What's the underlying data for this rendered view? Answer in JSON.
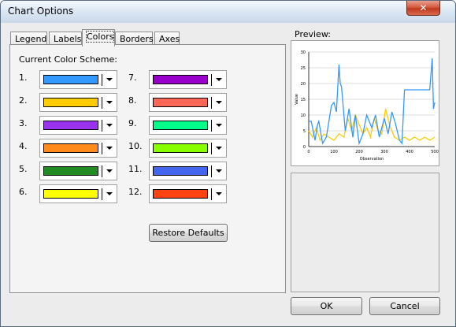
{
  "window": {
    "title": "Chart Options",
    "close_glyph": "✕"
  },
  "tabs": [
    {
      "label": "Legend"
    },
    {
      "label": "Labels"
    },
    {
      "label": "Colors"
    },
    {
      "label": "Borders"
    },
    {
      "label": "Axes"
    }
  ],
  "colors_panel": {
    "scheme_label": "Current Color Scheme:",
    "left_column": [
      {
        "num": "1.",
        "color": "#3399ff"
      },
      {
        "num": "2.",
        "color": "#ffcc00"
      },
      {
        "num": "3.",
        "color": "#9933ee"
      },
      {
        "num": "4.",
        "color": "#ff8c1a"
      },
      {
        "num": "5.",
        "color": "#228b22"
      },
      {
        "num": "6.",
        "color": "#ffff00"
      }
    ],
    "right_column": [
      {
        "num": "7.",
        "color": "#9900cc"
      },
      {
        "num": "8.",
        "color": "#ff6655"
      },
      {
        "num": "9.",
        "color": "#00ff88"
      },
      {
        "num": "10.",
        "color": "#88ff00"
      },
      {
        "num": "11.",
        "color": "#4466ee"
      },
      {
        "num": "12.",
        "color": "#ff4411"
      }
    ],
    "restore_label": "Restore Defaults"
  },
  "preview": {
    "label": "Preview:",
    "chart_data": {
      "type": "line",
      "xlabel": "Observation",
      "ylabel": "Value",
      "xlim": [
        0,
        500
      ],
      "ylim": [
        0,
        30
      ],
      "x_ticks": [
        "0",
        "100",
        "200",
        "300",
        "400",
        "500"
      ],
      "y_ticks": [
        "0",
        "5",
        "10",
        "15",
        "20",
        "25",
        "30"
      ],
      "series": [
        {
          "color": "#3399ff",
          "x": [
            0,
            10,
            25,
            35,
            40,
            55,
            70,
            90,
            100,
            110,
            120,
            125,
            130,
            145,
            160,
            175,
            185,
            200,
            215,
            230,
            250,
            265,
            280,
            300,
            315,
            330,
            345,
            360,
            370,
            380,
            400,
            420,
            440,
            460,
            480,
            490,
            495,
            500
          ],
          "y": [
            8,
            8,
            2,
            7,
            8,
            1,
            3,
            13,
            14,
            11,
            26,
            20,
            19,
            5,
            12,
            3,
            10,
            1,
            4,
            10,
            6,
            10,
            3,
            9,
            4,
            11,
            7,
            2,
            1,
            18,
            18,
            18,
            18,
            18,
            18,
            28,
            12,
            14
          ]
        },
        {
          "color": "#ffcc00",
          "x": [
            0,
            15,
            30,
            45,
            60,
            80,
            100,
            120,
            140,
            155,
            170,
            185,
            200,
            215,
            230,
            245,
            260,
            275,
            290,
            305,
            320,
            340,
            360,
            380,
            400,
            420,
            440,
            460,
            480,
            500
          ],
          "y": [
            5,
            3,
            6,
            2,
            4,
            3,
            2,
            4,
            3,
            9,
            5,
            10,
            7,
            4,
            6,
            3,
            9,
            5,
            4,
            12,
            7,
            3,
            2,
            3,
            2,
            3,
            2,
            3,
            2,
            3
          ]
        }
      ]
    }
  },
  "buttons": {
    "ok": "OK",
    "cancel": "Cancel"
  }
}
